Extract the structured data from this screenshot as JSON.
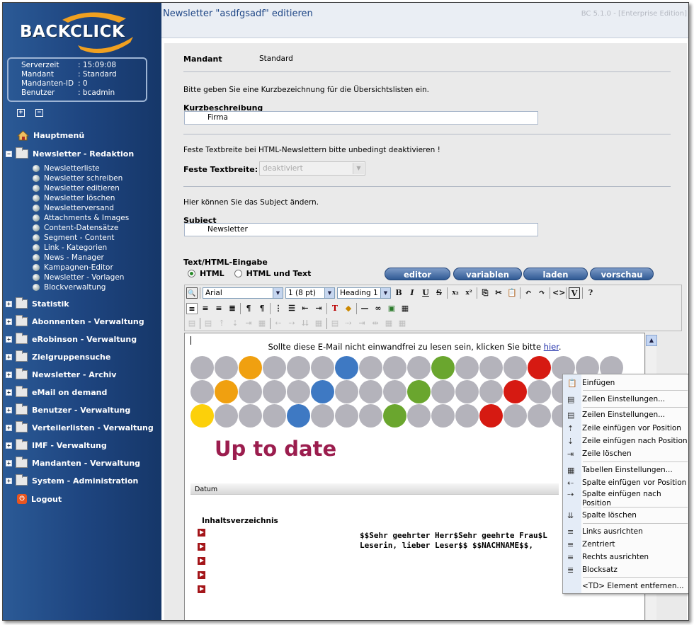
{
  "app": {
    "brand": "BACKCLICK",
    "header_title": "Newsletter \"asdfgsadf\" editieren",
    "version": "BC 5.1.0 - [Enterprise Edition]"
  },
  "info": {
    "server_label": "Serverzeit",
    "server_value": ": 15:09:08",
    "mandant_label": "Mandant",
    "mandant_value": ": Standard",
    "mandant_id_label": "Mandanten-ID",
    "mandant_id_value": ": 0",
    "user_label": "Benutzer",
    "user_value": ": bcadmin"
  },
  "nav": {
    "main_menu": "Hauptmenü",
    "redaktion": "Newsletter - Redaktion",
    "sub": [
      "Newsletterliste",
      "Newsletter schreiben",
      "Newsletter editieren",
      "Newsletter löschen",
      "Newsletterversand",
      "Attachments & Images",
      "Content-Datensätze",
      "Segment - Content",
      "Link - Kategorien",
      "News - Manager",
      "Kampagnen-Editor",
      "Newsletter - Vorlagen",
      "Blockverwaltung"
    ],
    "sections": [
      "Statistik",
      "Abonnenten - Verwaltung",
      "eRobinson - Verwaltung",
      "Zielgruppensuche",
      "Newsletter - Archiv",
      "eMail on demand",
      "Benutzer - Verwaltung",
      "Verteilerlisten - Verwaltung",
      "IMF - Verwaltung",
      "Mandanten - Verwaltung",
      "System - Administration"
    ],
    "logout": "Logout"
  },
  "form": {
    "mandant_label": "Mandant",
    "mandant_value": "Standard",
    "short_hint": "Bitte geben Sie eine Kurzbezeichnung für die Übersichtslisten ein.",
    "short_label": "Kurzbeschreibung",
    "short_value": "Firma",
    "width_hint": "Feste Textbreite bei HTML-Newslettern bitte unbedingt deaktivieren !",
    "width_label": "Feste Textbreite:",
    "width_value": "deaktiviert",
    "subject_hint": "Hier können Sie das Subject ändern.",
    "subject_label": "Subject",
    "subject_value": "Newsletter",
    "html_label": "Text/HTML-Eingabe",
    "radio_html": "HTML",
    "radio_html_text": "HTML und Text",
    "btn_editor": "editor",
    "btn_variablen": "variablen",
    "btn_laden": "laden",
    "btn_vorschau": "vorschau"
  },
  "toolbar": {
    "font": "Arial",
    "size": "1 (8 pt)",
    "style": "Heading 1"
  },
  "content": {
    "notice": "Sollte diese E-Mail nicht einwandfrei zu lesen sein, klicken Sie bitte ",
    "notice_link": "hier",
    "notice_end": ".",
    "headline": "Up to date",
    "datum": "Datum",
    "toc": "Inhaltsverzeichnis",
    "greeting_1": "$$Sehr geehrter Herr$Sehr geehrte Frau$L",
    "greeting_2": "Leserin, lieber Leser$$ $$NACHNAME$$,"
  },
  "ctx_menu": {
    "items": [
      "Einfügen",
      "Zellen Einstellungen...",
      "Zeilen Einstellungen...",
      "Zeile einfügen vor Position",
      "Zeile einfügen nach Position",
      "Zeile löschen",
      "Tabellen Einstellungen...",
      "Spalte einfügen vor Position",
      "Spalte einfügen nach Position",
      "Spalte löschen",
      "Links ausrichten",
      "Zentriert",
      "Rechts ausrichten",
      "Blocksatz",
      "<TD> Element entfernen..."
    ]
  },
  "colors": {
    "gray": "#b4b3bb",
    "orange": "#f0a010",
    "blue": "#3e79c3",
    "green": "#6aa62e",
    "red": "#d61a12",
    "yellow": "#fcd00a",
    "headline": "#9b1d4e"
  }
}
